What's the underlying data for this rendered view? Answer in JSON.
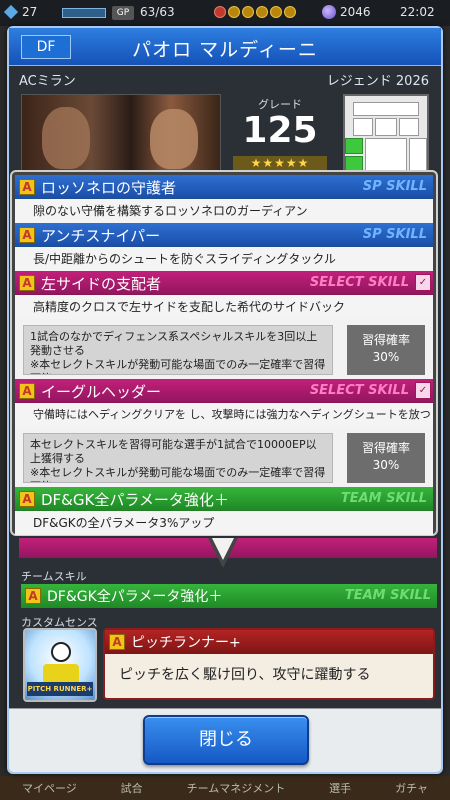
{
  "status_bar": {
    "level": "27",
    "gp": "63/63",
    "coins": "2046",
    "time": "22:02"
  },
  "bottom_menu": [
    "マイページ",
    "試合",
    "チームマネジメント",
    "選手",
    "ガチャ"
  ],
  "player": {
    "position": "DF",
    "name": "パオロ マルディーニ",
    "team": "ACミラン",
    "edition": "レジェンド 2026",
    "grade_label": "グレード",
    "grade": "125",
    "stars": "★★★★★"
  },
  "skills": [
    {
      "name": "ロッソネロの守護者",
      "type": "SP SKILL",
      "desc": "隙のない守備を構築するロッソネロのガーディアン"
    },
    {
      "name": "アンチスナイパー",
      "type": "SP SKILL",
      "desc": "長/中距離からのシュートを防ぐスライディングタックル"
    },
    {
      "name": "左サイドの支配者",
      "type": "SELECT SKILL",
      "desc": "高精度のクロスで左サイドを支配した希代のサイドバック",
      "condition": "1試合のなかでディフェンス系スペシャルスキルを3回以上発動させる\n※本セレクトスキルが発動可能な場面でのみ一定確率で習得可能",
      "rate_label": "習得確率",
      "rate": "30%"
    },
    {
      "name": "イーグルヘッダー",
      "type": "SELECT SKILL",
      "desc": "守備時にはヘディングクリアを し、攻撃時には強力なヘディングシュートを放つ",
      "condition": "本セレクトスキルを習得可能な選手が1試合で10000EP以上獲得する\n※本セレクトスキルが発動可能な場面でのみ一定確率で習得可能",
      "rate_label": "習得確率",
      "rate": "30%"
    },
    {
      "name": "DF&GK全パラメータ強化＋",
      "type": "TEAM SKILL",
      "desc": "DF&GKの全パラメータ3%アップ"
    }
  ],
  "team_skill": {
    "label": "チームスキル",
    "name": "DF&GK全パラメータ強化＋",
    "type": "TEAM SKILL"
  },
  "custom_sense": {
    "label": "カスタムセンス",
    "image_text": "PITCH RUNNER+",
    "name": "ピッチランナー+",
    "desc": "ピッチを広く駆け回り、攻守に躍動する"
  },
  "close_button": "閉じる",
  "colors": {
    "header_blue": "#1d6fd6",
    "sp_skill": "#2f6fd0",
    "select_skill": "#c2207a",
    "team_skill": "#36b53c",
    "sense_red": "#b32424"
  }
}
